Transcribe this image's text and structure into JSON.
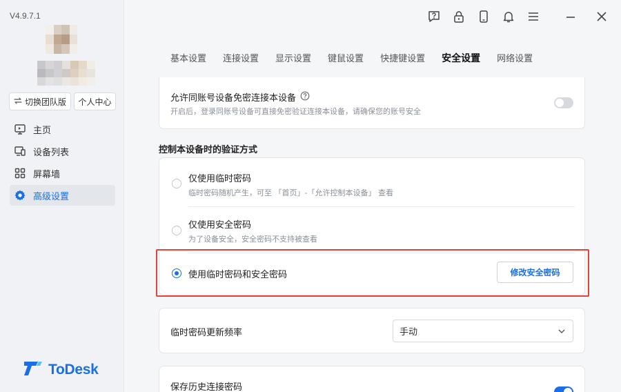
{
  "app": {
    "version": "V4.9.7.1",
    "brand_name": "ToDesk",
    "accent_color": "#1a6fe8",
    "highlight_color": "#e0453a"
  },
  "sidebar": {
    "switch_team_label": "切换团队版",
    "switch_team_icon": "swap-icon",
    "personal_center_label": "个人中心",
    "nav": [
      {
        "label": "主页",
        "icon": "monitor-icon",
        "active": false
      },
      {
        "label": "设备列表",
        "icon": "device-list-icon",
        "active": false
      },
      {
        "label": "屏幕墙",
        "icon": "grid-icon",
        "active": false
      },
      {
        "label": "高级设置",
        "icon": "gear-icon",
        "active": true
      }
    ]
  },
  "topbar": {
    "icons": [
      "help-icon",
      "lock-icon",
      "phone-icon",
      "bell-icon",
      "menu-icon",
      "minimize-icon",
      "close-icon"
    ]
  },
  "tabs": [
    {
      "label": "基本设置",
      "active": false
    },
    {
      "label": "连接设置",
      "active": false
    },
    {
      "label": "显示设置",
      "active": false
    },
    {
      "label": "键鼠设置",
      "active": false
    },
    {
      "label": "快捷键设置",
      "active": false
    },
    {
      "label": "安全设置",
      "active": true
    },
    {
      "label": "网络设置",
      "active": false
    }
  ],
  "same_account": {
    "title": "允许同账号设备免密连接本设备",
    "description": "开启后，登录同账号设备可直接免密验证连接本设备，请确保您的账号安全",
    "toggle_on": false
  },
  "verification": {
    "section_title": "控制本设备时的验证方式",
    "options": [
      {
        "label": "仅使用临时密码",
        "description": "临时密码随机产生，可至 「首页」-「允许控制本设备」 查看",
        "selected": false
      },
      {
        "label": "仅使用安全密码",
        "description": "为了设备安全，安全密码不支持被查看",
        "selected": false
      },
      {
        "label": "使用临时密码和安全密码",
        "description": "",
        "selected": true
      }
    ],
    "modify_button_label": "修改安全密码"
  },
  "temp_password_frequency": {
    "label": "临时密码更新频率",
    "value": "手动"
  },
  "history_password": {
    "label": "保存历史连接密码",
    "toggle_on": true
  }
}
